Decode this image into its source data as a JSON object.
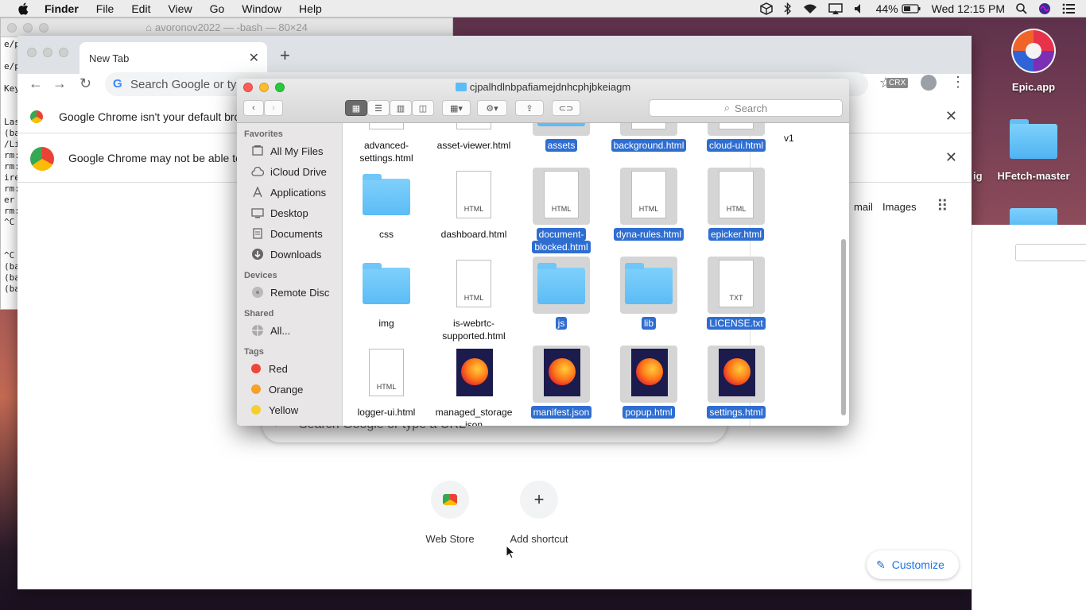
{
  "menubar": {
    "app": "Finder",
    "items": [
      "File",
      "Edit",
      "View",
      "Go",
      "Window",
      "Help"
    ],
    "battery": "44%",
    "clock": "Wed 12:15 PM"
  },
  "terminal": {
    "title": "avoronov2022 — -bash — 80×24",
    "lines": [
      "e/p",
      "",
      "e/p",
      "",
      "Key",
      "",
      "",
      "Las",
      "(ba",
      "/Li",
      "rm:",
      "rm:",
      "ire",
      "rm:",
      " er",
      "rm:",
      "^C",
      "",
      "",
      "^C",
      "(ba",
      "(ba",
      "(ba"
    ]
  },
  "desktop": {
    "icons": [
      {
        "label": "Epic.app"
      },
      {
        "label": "HFetch-master"
      }
    ],
    "peek_text": "ig"
  },
  "chrome": {
    "tab_title": "New Tab",
    "omnibox_placeholder": "Search Google or typ",
    "ext_label": "CRX",
    "infobar_default": "Google Chrome isn't your default bro",
    "infobar_update": "Google Chrome may not be able to",
    "ntp_links": [
      "mail",
      "Images"
    ],
    "ntp_search_placeholder": "Search Google or type a URL",
    "shortcuts": [
      {
        "label": "Web Store"
      },
      {
        "label": "Add shortcut"
      }
    ],
    "customize": "Customize"
  },
  "finder": {
    "title": "cjpalhdlnbpafiamejdnhcphjbkeiagm",
    "search_placeholder": "Search",
    "sidebar": {
      "favorites_header": "Favorites",
      "favorites": [
        "All My Files",
        "iCloud Drive",
        "Applications",
        "Desktop",
        "Documents",
        "Downloads"
      ],
      "devices_header": "Devices",
      "devices": [
        "Remote Disc"
      ],
      "shared_header": "Shared",
      "shared": [
        "All..."
      ],
      "tags_header": "Tags",
      "tags": [
        {
          "name": "Red",
          "color": "#f0433a"
        },
        {
          "name": "Orange",
          "color": "#f7a12a"
        },
        {
          "name": "Yellow",
          "color": "#f5cf2f"
        }
      ]
    },
    "files": [
      {
        "name": "advanced-settings.html",
        "line1": "advanced-",
        "line2": "settings.html",
        "kind": "html",
        "type_label": "HTML",
        "selected": false
      },
      {
        "name": "asset-viewer.html",
        "line1": "asset-viewer.html",
        "line2": "",
        "kind": "html",
        "type_label": "HTML",
        "selected": false
      },
      {
        "name": "assets",
        "line1": "assets",
        "line2": "",
        "kind": "folder",
        "type_label": "",
        "selected": true
      },
      {
        "name": "background.html",
        "line1": "background.html",
        "line2": "",
        "kind": "html",
        "type_label": "HTML",
        "selected": true
      },
      {
        "name": "cloud-ui.html",
        "line1": "cloud-ui.html",
        "line2": "",
        "kind": "html",
        "type_label": "HTML",
        "selected": true
      },
      {
        "name": "css",
        "line1": "css",
        "line2": "",
        "kind": "folder",
        "type_label": "",
        "selected": false
      },
      {
        "name": "dashboard.html",
        "line1": "dashboard.html",
        "line2": "",
        "kind": "html",
        "type_label": "HTML",
        "selected": false
      },
      {
        "name": "document-blocked.html",
        "line1": "document-",
        "line2": "blocked.html",
        "kind": "html",
        "type_label": "HTML",
        "selected": true
      },
      {
        "name": "dyna-rules.html",
        "line1": "dyna-rules.html",
        "line2": "",
        "kind": "html",
        "type_label": "HTML",
        "selected": true
      },
      {
        "name": "epicker.html",
        "line1": "epicker.html",
        "line2": "",
        "kind": "html",
        "type_label": "HTML",
        "selected": true
      },
      {
        "name": "img",
        "line1": "img",
        "line2": "",
        "kind": "folder",
        "type_label": "",
        "selected": false
      },
      {
        "name": "is-webrtc-supported.html",
        "line1": "is-webrtc-",
        "line2": "supported.html",
        "kind": "html",
        "type_label": "HTML",
        "selected": false
      },
      {
        "name": "js",
        "line1": "js",
        "line2": "",
        "kind": "folder",
        "type_label": "",
        "selected": true
      },
      {
        "name": "lib",
        "line1": "lib",
        "line2": "",
        "kind": "folder",
        "type_label": "",
        "selected": true
      },
      {
        "name": "LICENSE.txt",
        "line1": "LICENSE.txt",
        "line2": "",
        "kind": "txt",
        "type_label": "TXT",
        "selected": true
      },
      {
        "name": "logger-ui.html",
        "line1": "logger-ui.html",
        "line2": "",
        "kind": "html",
        "type_label": "HTML",
        "selected": false
      },
      {
        "name": "managed_storage.json",
        "line1": "managed_storage",
        "line2": "json",
        "kind": "ff",
        "type_label": "",
        "selected": false
      },
      {
        "name": "manifest.json",
        "line1": "manifest.json",
        "line2": "",
        "kind": "ff",
        "type_label": "",
        "selected": true
      },
      {
        "name": "popup.html",
        "line1": "popup.html",
        "line2": "",
        "kind": "ff",
        "type_label": "",
        "selected": true
      },
      {
        "name": "settings.html",
        "line1": "settings.html",
        "line2": "",
        "kind": "ff",
        "type_label": "",
        "selected": true
      }
    ],
    "extra_label": "v1"
  }
}
